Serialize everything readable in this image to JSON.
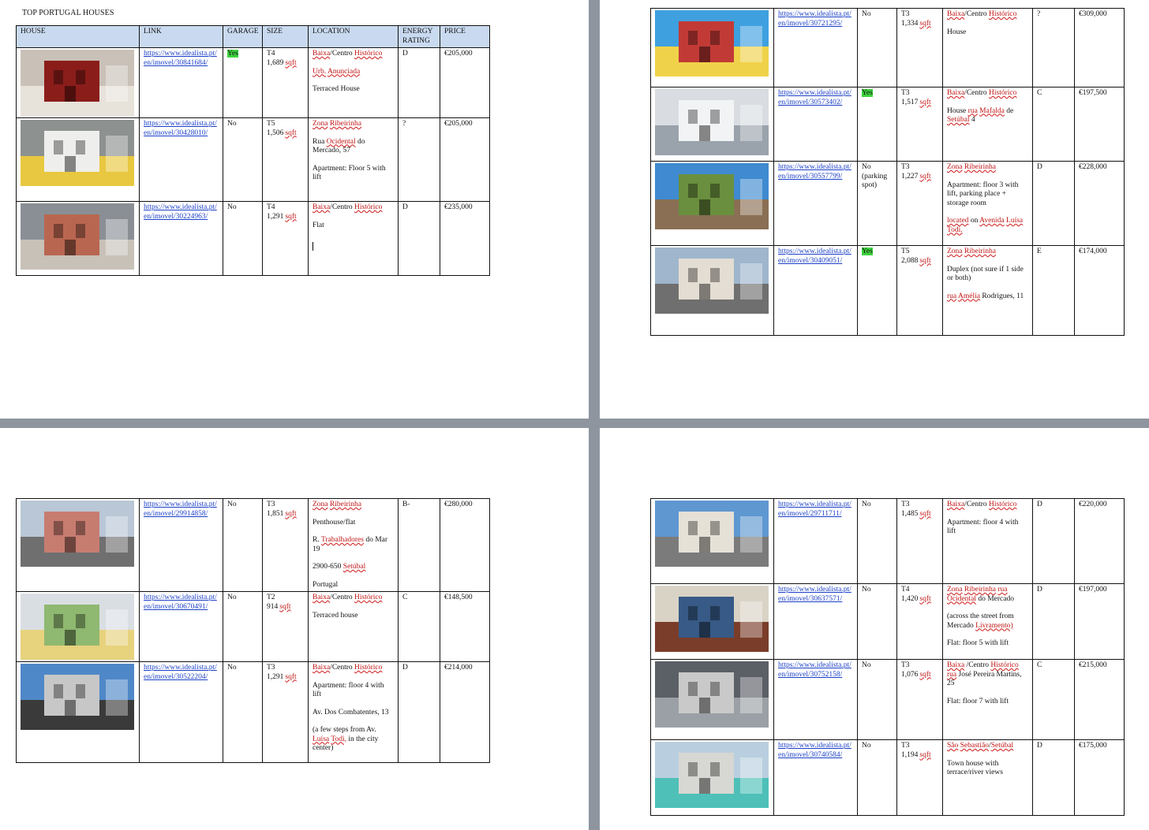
{
  "document": {
    "title": "TOP PORTUGAL HOUSES"
  },
  "headers": {
    "house": "HOUSE",
    "link": "LINK",
    "garage": "GARAGE",
    "size": "SIZE",
    "location": "LOCATION",
    "energy": "ENERGY RATING",
    "price": "PRICE"
  },
  "pages": [
    {
      "rows": [
        {
          "link": "https://www.idealista.pt/en/imovel/30841684/",
          "garage": "Yes",
          "garage_highlight": true,
          "size_type": "T4",
          "size_area": "1,689",
          "size_unit": "sqft",
          "location": [
            "Baixa/Centro Histórico",
            "Urb. Anunciada",
            "Terraced House"
          ],
          "energy": "D",
          "price": "€205,000",
          "img": "interior"
        },
        {
          "link": "https://www.idealista.pt/en/imovel/30428010/",
          "garage": "No",
          "size_type": "T5",
          "size_area": "1,506",
          "size_unit": "sqft",
          "location": [
            "Zona Ribeirinha",
            "Rua Ocidental do Mercado, 57",
            "Apartment: Floor 5 with lift"
          ],
          "energy": "?",
          "price": "€205,000",
          "img": "kitchen"
        },
        {
          "link": "https://www.idealista.pt/en/imovel/30224963/",
          "garage": "No",
          "size_type": "T4",
          "size_area": "1,291",
          "size_unit": "sqft",
          "location": [
            "Baixa/Centro Histórico",
            "Flat"
          ],
          "energy": "D",
          "price": "€235,000",
          "img": "street-red"
        }
      ]
    },
    {
      "rows": [
        {
          "link": "https://www.idealista.pt/en/imovel/30721295/",
          "garage": "No",
          "size_type": "T3",
          "size_area": "1,334",
          "size_unit": "sqft",
          "location": [
            "Baixa/Centro Histórico",
            "House"
          ],
          "energy": "?",
          "price": "€309,000",
          "img": "facade-red"
        },
        {
          "link": "https://www.idealista.pt/en/imovel/30573402/",
          "garage": "Yes",
          "garage_highlight": true,
          "size_type": "T3",
          "size_area": "1,517",
          "size_unit": "sqft",
          "location": [
            "Baixa/Centro Histórico",
            "House rua Mafalda de Setúbal 4"
          ],
          "energy": "C",
          "price": "€197,500",
          "img": "white-building"
        },
        {
          "link": "https://www.idealista.pt/en/imovel/30557799/",
          "garage": "No (parking spot)",
          "size_type": "T3",
          "size_area": "1,227",
          "size_unit": "sqft",
          "location": [
            "Zona Ribeirinha",
            "Apartment: floor 3 with lift, parking place + storage room",
            "located on Avenida Luísa Todi."
          ],
          "energy": "D",
          "price": "€228,000",
          "img": "balcony"
        },
        {
          "link": "https://www.idealista.pt/en/imovel/30409051/",
          "garage": "Yes",
          "garage_highlight": true,
          "size_type": "T5",
          "size_area": "2,088",
          "size_unit": "sqft",
          "location": [
            "Zona Ribeirinha",
            "Duplex (not sure if 1 side or both)",
            "rua Amélia Rodrigues, 11"
          ],
          "energy": "E",
          "price": "€174,000",
          "img": "duplex"
        }
      ]
    },
    {
      "rows": [
        {
          "link": "https://www.idealista.pt/en/imovel/29914858/",
          "garage": "No",
          "size_type": "T3",
          "size_area": "1,851",
          "size_unit": "sqft",
          "location": [
            "Zona Ribeirinha",
            "Penthouse/flat",
            "R. Trabalhadores do Mar 19",
            "2900-650 Setúbal",
            "Portugal"
          ],
          "energy": "B-",
          "price": "€280,000",
          "img": "pink-building"
        },
        {
          "link": "https://www.idealista.pt/en/imovel/30670491/",
          "garage": "No",
          "size_type": "T2",
          "size_area": "914",
          "size_unit": "sqft",
          "location": [
            "Baixa/Centro Histórico",
            "Terraced house"
          ],
          "energy": "C",
          "price": "€148,500",
          "img": "green-house"
        },
        {
          "link": "https://www.idealista.pt/en/imovel/30522204/",
          "garage": "No",
          "size_type": "T3",
          "size_area": "1,291",
          "size_unit": "sqft",
          "location": [
            "Baixa/Centro Histórico",
            "Apartment: floor 4 with lift",
            "Av. Dos Combatentes, 13",
            "(a few steps from Av. Luísa Todi, in the city center)"
          ],
          "energy": "D",
          "price": "€214,000",
          "img": "terrace"
        }
      ]
    },
    {
      "rows": [
        {
          "link": "https://www.idealista.pt/en/imovel/29711711/",
          "garage": "No",
          "size_type": "T3",
          "size_area": "1,485",
          "size_unit": "sqft",
          "location": [
            "Baixa/Centro Histórico",
            "Apartment: floor 4 with lift"
          ],
          "energy": "D",
          "price": "€220,000",
          "img": "balcony-view"
        },
        {
          "link": "https://www.idealista.pt/en/imovel/30637571/",
          "garage": "No",
          "size_type": "T4",
          "size_area": "1,420",
          "size_unit": "sqft",
          "location": [
            "Zona Ribeirinha rua Ocidental do Mercado",
            "(across the street from Mercado Livramento)",
            "Flat: floor 5 with lift"
          ],
          "energy": "D",
          "price": "€197,000",
          "img": "living-room"
        },
        {
          "link": "https://www.idealista.pt/en/imovel/30752158/",
          "garage": "No",
          "size_type": "T3",
          "size_area": "1,076",
          "size_unit": "sqft",
          "location": [
            "Baixa /Centro Histórico rua José Pereira Martins, 25",
            "Flat: floor 7 with lift"
          ],
          "energy": "C",
          "price": "€215,000",
          "img": "grey-kitchen"
        },
        {
          "link": "https://www.idealista.pt/en/imovel/30740584/",
          "garage": "No",
          "size_type": "T3",
          "size_area": "1,194",
          "size_unit": "sqft",
          "location": [
            "São Sebastião/Setúbal",
            "Town house with terrace/river views"
          ],
          "energy": "D",
          "price": "€175,000",
          "img": "small-house"
        }
      ]
    }
  ],
  "image_palette": {
    "interior": [
      "#c9c1b8",
      "#8a1d1a",
      "#e7e2da"
    ],
    "kitchen": [
      "#8d918f",
      "#eeeeec",
      "#e8c840"
    ],
    "street-red": [
      "#8a8f95",
      "#b96651",
      "#c7c1b8"
    ],
    "facade-red": [
      "#3fa0e0",
      "#c23a36",
      "#f0d24a"
    ],
    "white-building": [
      "#d9dde2",
      "#f2f3f4",
      "#9aa3ab"
    ],
    "balcony": [
      "#3f8ad0",
      "#6a8f3e",
      "#8a6f54"
    ],
    "duplex": [
      "#9fb6cc",
      "#e3ddd3",
      "#6f6f6f"
    ],
    "pink-building": [
      "#b9c7d6",
      "#c77c70",
      "#6f6f6f"
    ],
    "green-house": [
      "#d9dee3",
      "#8fb870",
      "#e7d27d"
    ],
    "terrace": [
      "#4f88c8",
      "#c7c7c7",
      "#3a3a3a"
    ],
    "balcony-view": [
      "#5f97d1",
      "#e6e1d7",
      "#7b7b7b"
    ],
    "living-room": [
      "#d9d3c6",
      "#375a86",
      "#7a3d2a"
    ],
    "grey-kitchen": [
      "#5b5f66",
      "#c9c9c9",
      "#9aa0a5"
    ],
    "small-house": [
      "#b9cfdf",
      "#d7d7d3",
      "#4ec0b8"
    ]
  }
}
